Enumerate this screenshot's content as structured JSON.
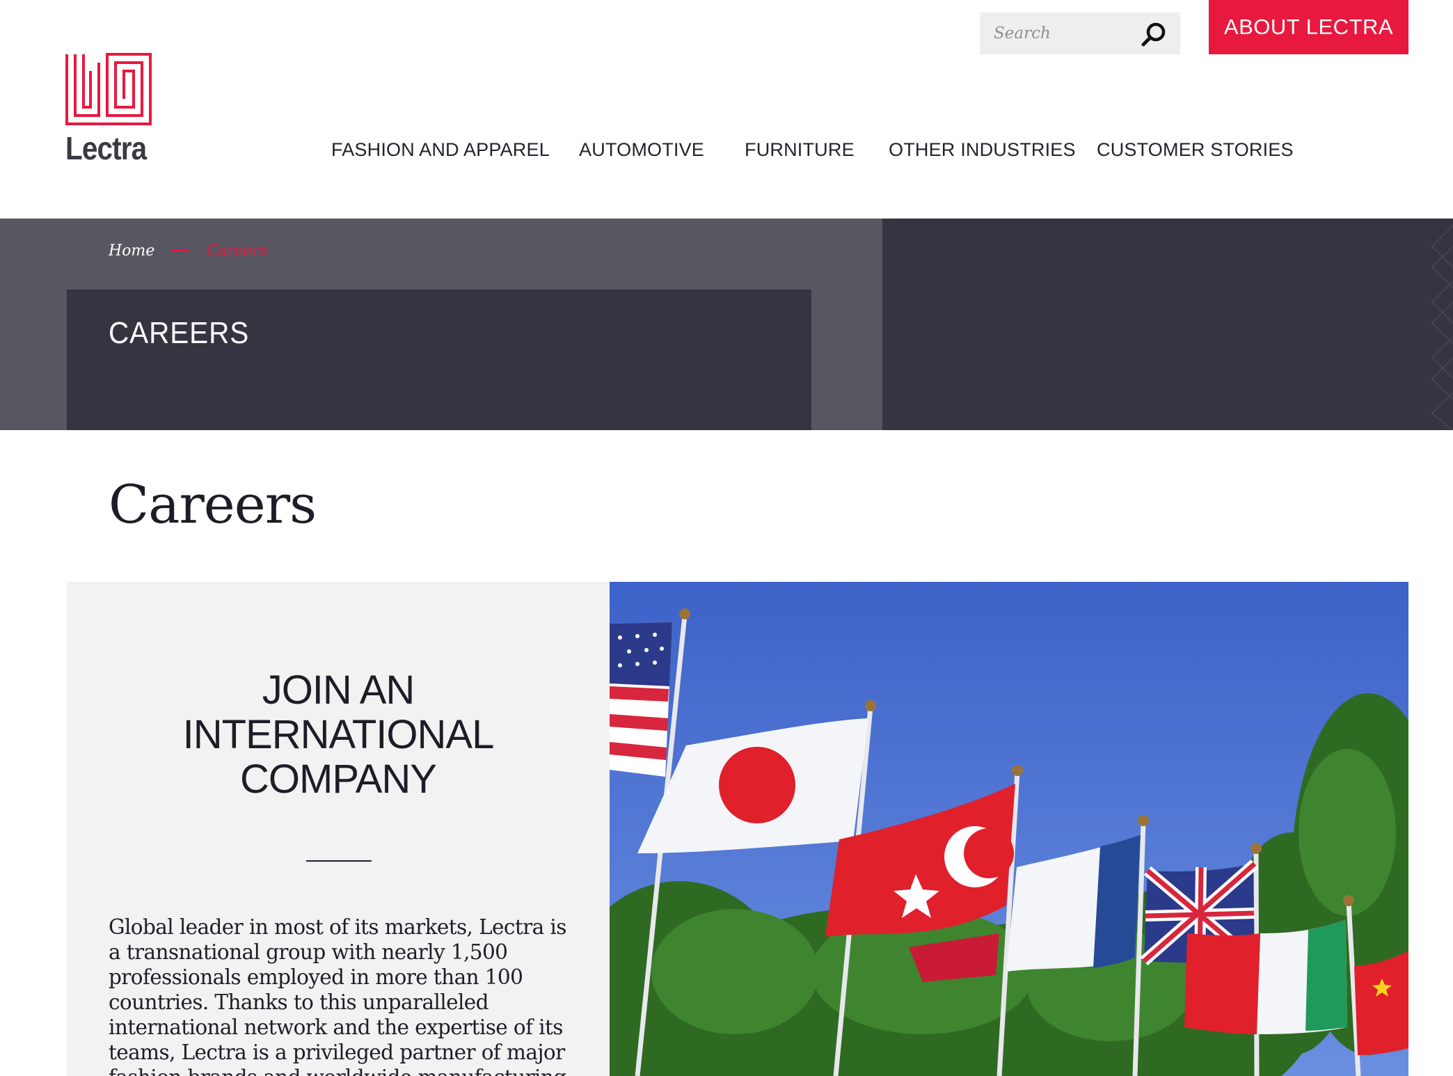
{
  "brand": {
    "name": "Lectra",
    "accent_color": "#e8193f",
    "dark_color": "#353441"
  },
  "header": {
    "search_placeholder": "Search",
    "about_label": "ABOUT LECTRA",
    "nav": [
      {
        "label": "FASHION AND APPAREL"
      },
      {
        "label": "AUTOMOTIVE"
      },
      {
        "label": "FURNITURE"
      },
      {
        "label": "OTHER INDUSTRIES"
      },
      {
        "label": "CUSTOMER STORIES"
      }
    ]
  },
  "hero": {
    "breadcrumb": {
      "home": "Home",
      "current": "Careers"
    },
    "title": "CAREERS"
  },
  "main": {
    "heading": "Careers",
    "feature": {
      "title": "JOIN AN\nINTERNATIONAL\nCOMPANY",
      "body": "Global leader in most of its markets, Lectra is a transnational group with nearly 1,500 professionals employed in more than 100 countries. Thanks to this unparalleled international network and the expertise of its teams, Lectra is a privileged partner of major fashion brands and worldwide manufacturing"
    }
  }
}
